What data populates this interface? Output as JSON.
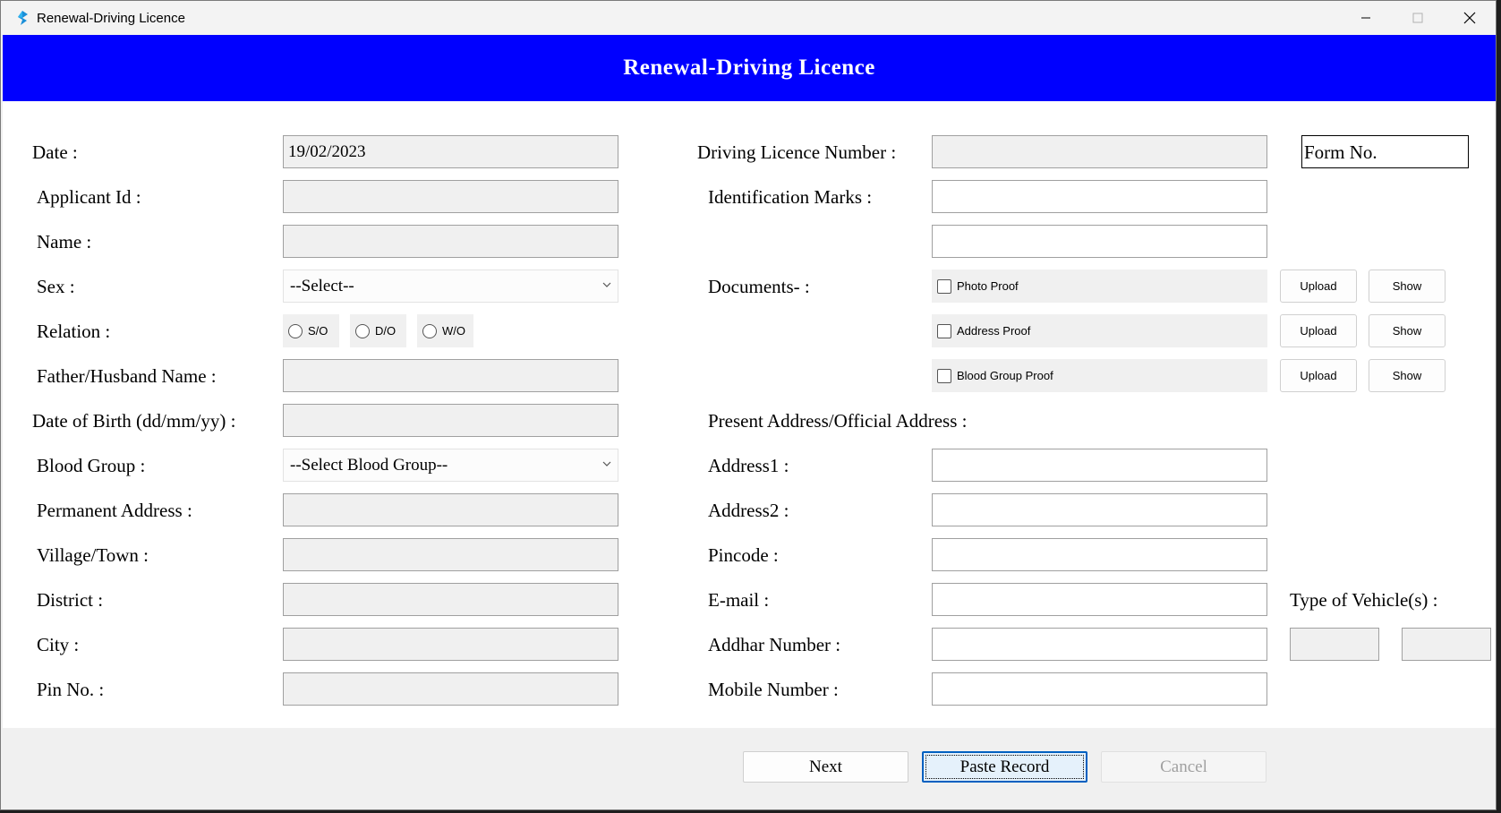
{
  "window": {
    "title": "Renewal-Driving Licence"
  },
  "banner": {
    "title": "Renewal-Driving Licence"
  },
  "left": {
    "date_label": "Date :",
    "date_value": "19/02/2023",
    "applicant_id_label": "Applicant Id :",
    "name_label": "Name :",
    "sex_label": "Sex :",
    "sex_value": "--Select--",
    "relation_label": "Relation :",
    "relation_options": [
      "S/O",
      "D/O",
      "W/O"
    ],
    "father_label": "Father/Husband Name :",
    "dob_label": "Date of Birth (dd/mm/yy) :",
    "blood_group_label": "Blood Group :",
    "blood_group_value": "--Select Blood Group--",
    "perm_address_label": "Permanent Address :",
    "village_label": "Village/Town :",
    "district_label": "District :",
    "city_label": "City :",
    "pin_label": "Pin No. :"
  },
  "right": {
    "dl_number_label": "Driving Licence Number :",
    "form_no_value": "Form No.",
    "id_marks_label": "Identification Marks :",
    "documents_label": "Documents- :",
    "documents": [
      {
        "label": "Photo Proof",
        "upload": "Upload",
        "show": "Show"
      },
      {
        "label": "Address Proof",
        "upload": "Upload",
        "show": "Show"
      },
      {
        "label": "Blood Group Proof",
        "upload": "Upload",
        "show": "Show"
      }
    ],
    "present_address_label": "Present Address/Official Address :",
    "address1_label": "Address1 :",
    "address2_label": "Address2 :",
    "pincode_label": "Pincode :",
    "email_label": "E-mail :",
    "aadhar_label": "Addhar Number :",
    "mobile_label": "Mobile Number :",
    "vehicle_type_label": "Type of Vehicle(s) :"
  },
  "footer": {
    "next": "Next",
    "paste": "Paste Record",
    "cancel": "Cancel"
  }
}
